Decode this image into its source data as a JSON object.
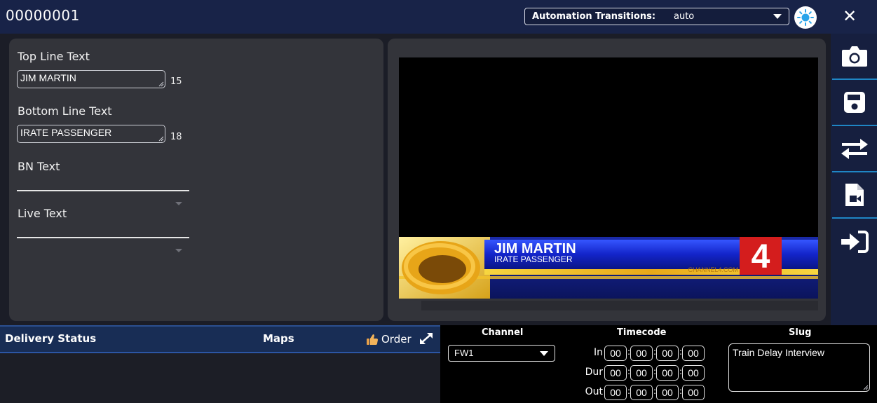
{
  "window": {
    "title": "00000001"
  },
  "automation": {
    "label": "Automation Transitions:",
    "value": "auto"
  },
  "form": {
    "top_line": {
      "label": "Top Line Text",
      "value": "JIM MARTIN",
      "count": "15"
    },
    "bottom_line": {
      "label": "Bottom Line Text",
      "value": "IRATE PASSENGER",
      "count": "18"
    },
    "bn_text": {
      "label": "BN Text",
      "value": ""
    },
    "live_text": {
      "label": "Live Text",
      "value": ""
    }
  },
  "preview": {
    "lower_third_name": "JIM MARTIN",
    "lower_third_title": "IRATE PASSENGER",
    "channel_number": "4",
    "website": "CHANNEL4.COM"
  },
  "toolbar": {
    "icons": [
      "camera-icon",
      "save-icon",
      "transfer-icon",
      "export-file-icon",
      "sign-in-icon"
    ]
  },
  "delivery": {
    "status_label": "Delivery Status",
    "maps_label": "Maps",
    "order_label": "Order"
  },
  "meta": {
    "channel_header": "Channel",
    "timecode_header": "Timecode",
    "slug_header": "Slug",
    "channel_value": "FW1",
    "timecodes": {
      "in": {
        "label": "In",
        "values": [
          "00",
          "00",
          "00",
          "00"
        ]
      },
      "dur": {
        "label": "Dur",
        "values": [
          "00",
          "00",
          "00",
          "00"
        ]
      },
      "out": {
        "label": "Out",
        "values": [
          "00",
          "00",
          "00",
          "00"
        ]
      }
    },
    "slug_value": "Train Delay Interview"
  },
  "colors": {
    "topbar": "#182348",
    "accent": "#1f86c5",
    "panel": "#33343a",
    "delivery_header": "#182d55"
  }
}
